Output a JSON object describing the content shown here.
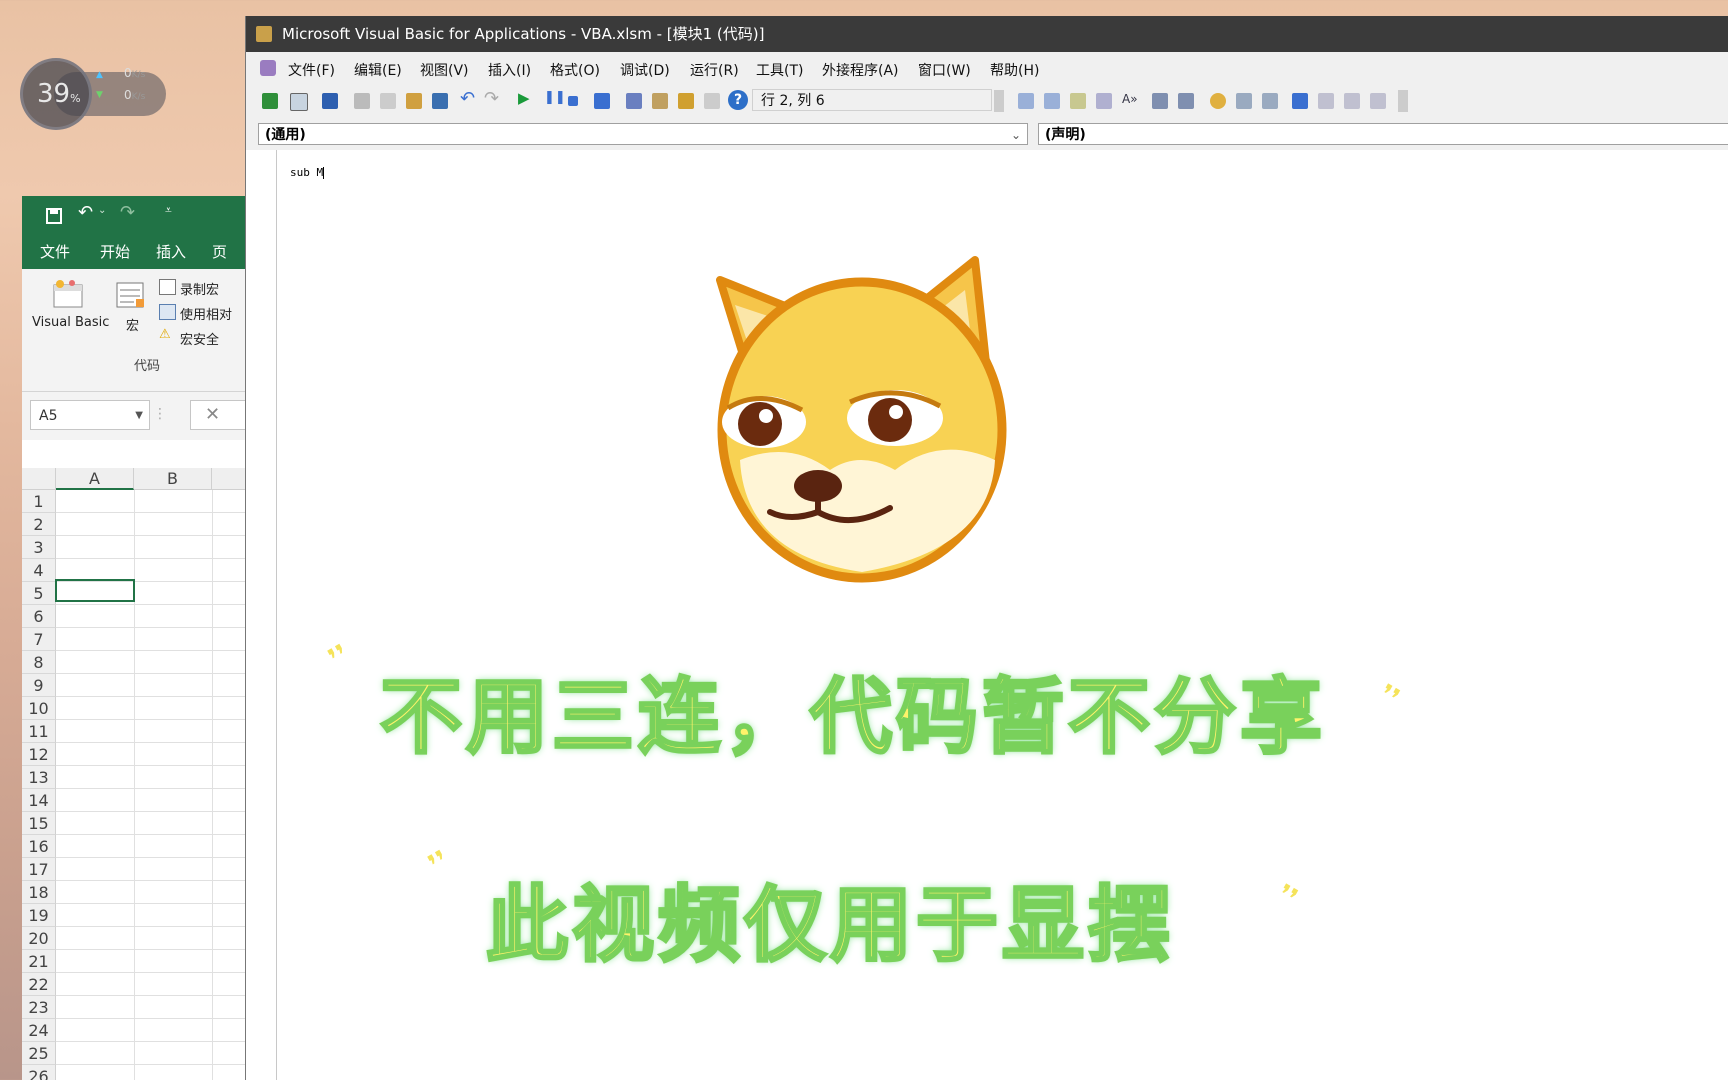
{
  "net_widget": {
    "percent": "39",
    "percent_unit": "%",
    "upload": "0",
    "upload_unit": "K/s",
    "download": "0",
    "download_unit": "K/s"
  },
  "excel": {
    "tabs": [
      "文件",
      "开始",
      "插入",
      "页"
    ],
    "ribbon": {
      "visual_basic": "Visual Basic",
      "macros": "宏",
      "record_macro": "录制宏",
      "relative_ref": "使用相对",
      "macro_security": "宏安全",
      "group_label": "代码"
    },
    "name_box": "A5",
    "formula_x": "✕",
    "columns": [
      "A",
      "B"
    ],
    "rows": [
      "1",
      "2",
      "3",
      "4",
      "5",
      "6",
      "7",
      "8",
      "9",
      "10",
      "11",
      "12",
      "13",
      "14",
      "15",
      "16",
      "17",
      "18",
      "19",
      "20",
      "21",
      "22",
      "23",
      "24",
      "25",
      "26"
    ],
    "selected_cell": "A5"
  },
  "vba": {
    "title": "Microsoft Visual Basic for Applications - VBA.xlsm - [模块1 (代码)]",
    "menu": [
      "文件(F)",
      "编辑(E)",
      "视图(V)",
      "插入(I)",
      "格式(O)",
      "调试(D)",
      "运行(R)",
      "工具(T)",
      "外接程序(A)",
      "窗口(W)",
      "帮助(H)"
    ],
    "position": "行 2, 列 6",
    "object_combo": "(通用)",
    "proc_combo": "(声明)",
    "code": "sub M"
  },
  "overlay": {
    "line1": "不用三连，代码暂不分享",
    "line2": "此视频仅用于显摆"
  },
  "colors": {
    "excel_green": "#217346",
    "vba_title": "#3a3a3a",
    "caption_fill": "#fff36a",
    "caption_stroke": "#79d15b"
  }
}
